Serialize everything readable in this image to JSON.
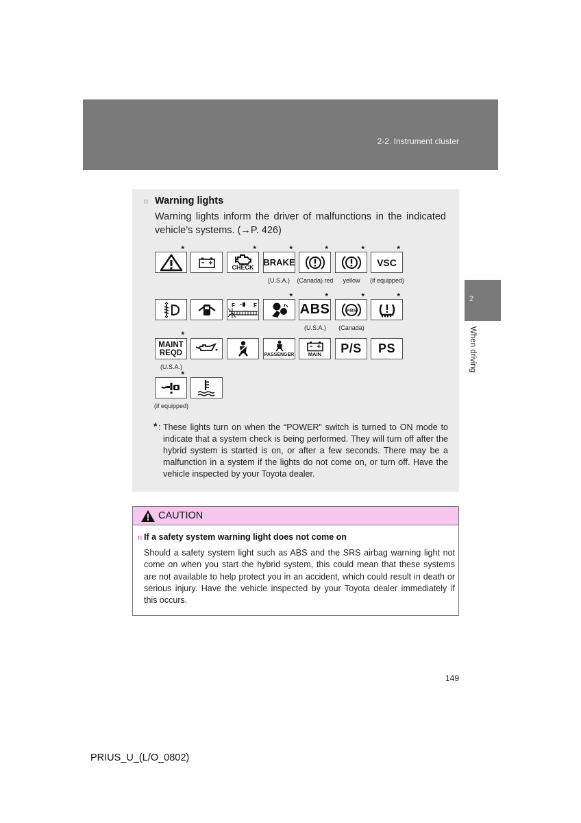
{
  "header": {
    "section_title": "2-2. Instrument cluster"
  },
  "side_tab": {
    "chapter_number": "2",
    "chapter_label": "When driving"
  },
  "warning_lights": {
    "bullet": "n",
    "heading": "Warning lights",
    "intro": "Warning lights inform the driver of malfunctions in the indicated vehicle’s systems. (→P. 426)",
    "rows": [
      [
        {
          "icon": "master-warning-icon",
          "star": "*",
          "caption": ""
        },
        {
          "icon": "charging-system-icon",
          "star": "",
          "caption": ""
        },
        {
          "icon": "check-engine-icon",
          "label": "CHECK",
          "star": "*",
          "caption": ""
        },
        {
          "icon": "brake-text-icon",
          "label": "BRAKE",
          "star": "*",
          "caption": "(U.S.A.)"
        },
        {
          "icon": "brake-circle-icon",
          "star": "*",
          "caption": "(Canada) red"
        },
        {
          "icon": "brake-circle-yellow-icon",
          "star": "*",
          "caption": "yellow"
        },
        {
          "icon": "vsc-icon",
          "label": "VSC",
          "star": "*",
          "caption": "(if equipped)"
        }
      ],
      [
        {
          "icon": "auto-leveling-headlight-icon",
          "star": "",
          "caption": ""
        },
        {
          "icon": "open-door-icon",
          "star": "",
          "caption": ""
        },
        {
          "icon": "low-fuel-icon",
          "label_left": "E",
          "label_right": "F",
          "star": "",
          "caption": ""
        },
        {
          "icon": "srs-airbag-icon",
          "star": "*",
          "caption": ""
        },
        {
          "icon": "abs-text-icon",
          "label": "ABS",
          "star": "*",
          "caption": "(U.S.A.)"
        },
        {
          "icon": "abs-circle-icon",
          "label": "ABS",
          "star": "*",
          "caption": "(Canada)"
        },
        {
          "icon": "tire-pressure-icon",
          "star": "*",
          "caption": ""
        }
      ],
      [
        {
          "icon": "maint-reqd-icon",
          "label": "MAINT REQD",
          "star": "*",
          "caption": "(U.S.A.)"
        },
        {
          "icon": "oil-pressure-icon",
          "star": "",
          "caption": ""
        },
        {
          "icon": "seat-belt-icon",
          "star": "",
          "caption": ""
        },
        {
          "icon": "passenger-seat-belt-icon",
          "label": "PASSENGER",
          "star": "",
          "caption": ""
        },
        {
          "icon": "main-battery-icon",
          "label": "MAIN",
          "star": "",
          "caption": ""
        },
        {
          "icon": "ps-slash-icon",
          "label": "P/S",
          "star": "",
          "caption": ""
        },
        {
          "icon": "ps-icon",
          "label": "PS",
          "star": "",
          "caption": ""
        }
      ],
      [
        {
          "icon": "cruise-control-icon",
          "star": "*",
          "caption": "(if equipped)"
        },
        {
          "icon": "high-coolant-temp-icon",
          "star": "",
          "caption": ""
        }
      ]
    ],
    "footnote_mark": "*",
    "footnote": "These lights turn on when the “POWER” switch is turned to ON mode to indicate that a system check is being performed. They will turn off after the hybrid system is started is on, or after a few seconds. There may be a malfunction in a system if the lights do not come on, or turn off. Have the vehicle inspected by your Toyota dealer."
  },
  "caution": {
    "title": "CAUTION",
    "bullet": "n",
    "heading": "If a safety system warning light does not come on",
    "body": "Should a safety system light such as ABS and the SRS airbag warning light not come on when you start the hybrid system, this could mean that these systems are not available to help protect you in an accident, which could result in death or serious injury. Have the vehicle inspected by your Toyota dealer immediately if this occurs.",
    "accent_color": "#f7c7f0"
  },
  "footer": {
    "page_number": "149",
    "doc_code": "PRIUS_U_(L/O_0802)"
  }
}
